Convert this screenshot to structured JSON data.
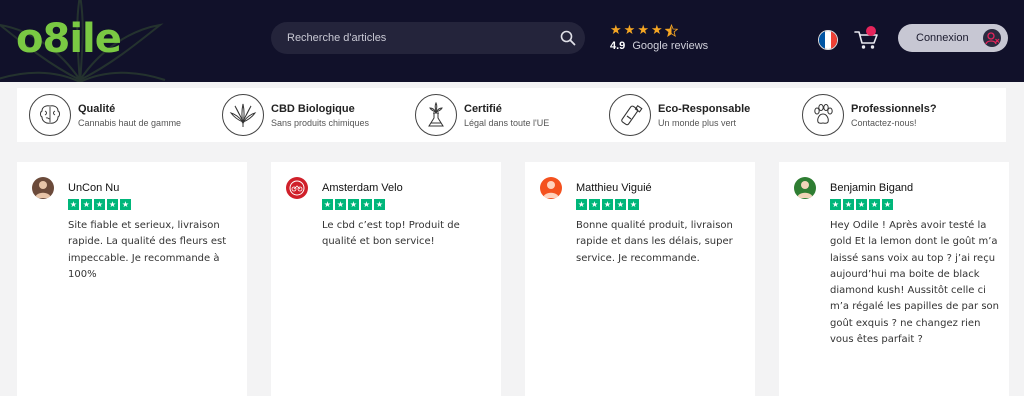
{
  "header": {
    "logo_text": "o8ile",
    "search": {
      "placeholder": "Recherche d'articles"
    },
    "google_reviews": {
      "rating": "4.9",
      "label": "Google reviews",
      "stars": 4.5
    },
    "language": "fr",
    "cart": {
      "has_badge": true
    },
    "login_label": "Connexion"
  },
  "features": [
    {
      "icon": "brain-icon",
      "title": "Qualité",
      "subtitle": "Cannabis haut de gamme"
    },
    {
      "icon": "cannabis-leaf-icon",
      "title": "CBD Biologique",
      "subtitle": "Sans produits chimiques"
    },
    {
      "icon": "flask-icon",
      "title": "Certifié",
      "subtitle": "Légal dans toute l'UE"
    },
    {
      "icon": "bottle-icon",
      "title": "Eco-Responsable",
      "subtitle": "Un monde plus vert"
    },
    {
      "icon": "paw-icon",
      "title": "Professionnels?",
      "subtitle": "Contactez-nous!"
    }
  ],
  "reviews": [
    {
      "name": "UnCon Nu",
      "stars": 5,
      "avatar_color": "#6b4a3a",
      "text": "Site fiable et serieux, livraison rapide. La qualité des fleurs est impeccable. Je recommande à 100%"
    },
    {
      "name": "Amsterdam Velo",
      "stars": 5,
      "avatar_color": "#d0202a",
      "text": "Le cbd c’est top! Produit de qualité et bon service!"
    },
    {
      "name": "Matthieu Viguié",
      "stars": 5,
      "avatar_color": "#f4511e",
      "text": "Bonne qualité produit, livraison rapide et dans les délais, super service. Je recommande."
    },
    {
      "name": "Benjamin Bigand",
      "stars": 5,
      "avatar_color": "#2e7d32",
      "text": "Hey Odile ! Après avoir testé la gold Et la lemon dont le goût m’a laissé sans voix au top ? j’ai reçu aujourd’hui ma boite de black diamond kush! Aussitôt celle ci m’a régalé les papilles de par son goût exquis ? ne changez rien vous êtes parfait ?"
    }
  ],
  "colors": {
    "header_bg": "#11112a",
    "brand_green": "#7ac943",
    "trustpilot_green": "#00b67a",
    "cart_badge": "#e6245b",
    "google_star": "#f5a623"
  }
}
